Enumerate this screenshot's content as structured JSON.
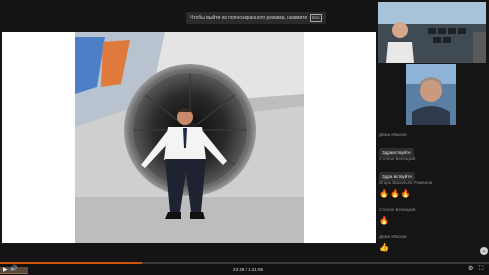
{
  "fullscreen_hint": {
    "text": "Чтобы выйти из полноэкранного режима, нажмите",
    "key": "Esc"
  },
  "chat": [
    {
      "author": "Дима Ивахов",
      "type": "text",
      "text": "Здравствуйте"
    },
    {
      "author": "Степан Белецкий",
      "type": "text",
      "text": "Здра вствуйте"
    },
    {
      "author": "Игорь Васильев Романов",
      "type": "emoji",
      "text": "🔥🔥🔥"
    },
    {
      "author": "Степан Белецкий",
      "type": "emoji",
      "text": "🔥"
    },
    {
      "author": "Дима Ивахов",
      "type": "emoji",
      "text": "👍"
    }
  ],
  "player": {
    "time": "23:49 / 1:21:06",
    "progress_fraction": 0.29,
    "play_icon": "▶",
    "volume_icon": "🔊",
    "settings_icon": "⚙",
    "fullscreen_icon": "⛶",
    "scroll_down_icon": "⌄"
  },
  "colors": {
    "accent": "#d35400",
    "background": "#141414"
  }
}
